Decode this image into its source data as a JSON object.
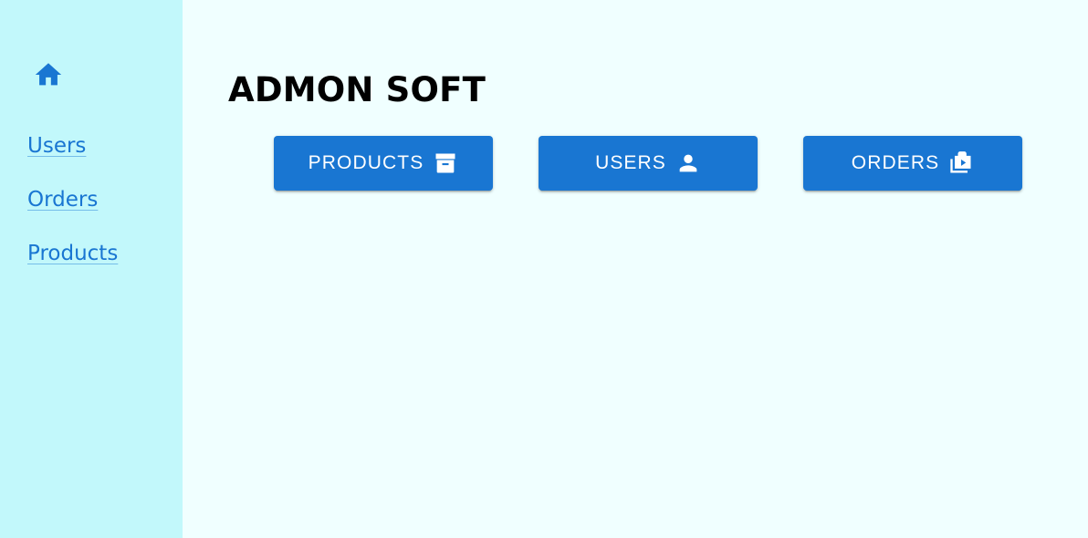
{
  "sidebar": {
    "home_icon": "home-icon",
    "items": [
      {
        "label": "Users"
      },
      {
        "label": "Orders"
      },
      {
        "label": "Products"
      }
    ]
  },
  "main": {
    "title": "ADMON SOFT",
    "buttons": [
      {
        "label": "PRODUCTS",
        "icon": "archive-icon"
      },
      {
        "label": "USERS",
        "icon": "person-icon"
      },
      {
        "label": "ORDERS",
        "icon": "work-history-icon"
      }
    ]
  },
  "colors": {
    "sidebar_bg": "#c2f8fb",
    "main_bg": "#f0ffff",
    "primary": "#1976d2",
    "title": "#000000"
  }
}
